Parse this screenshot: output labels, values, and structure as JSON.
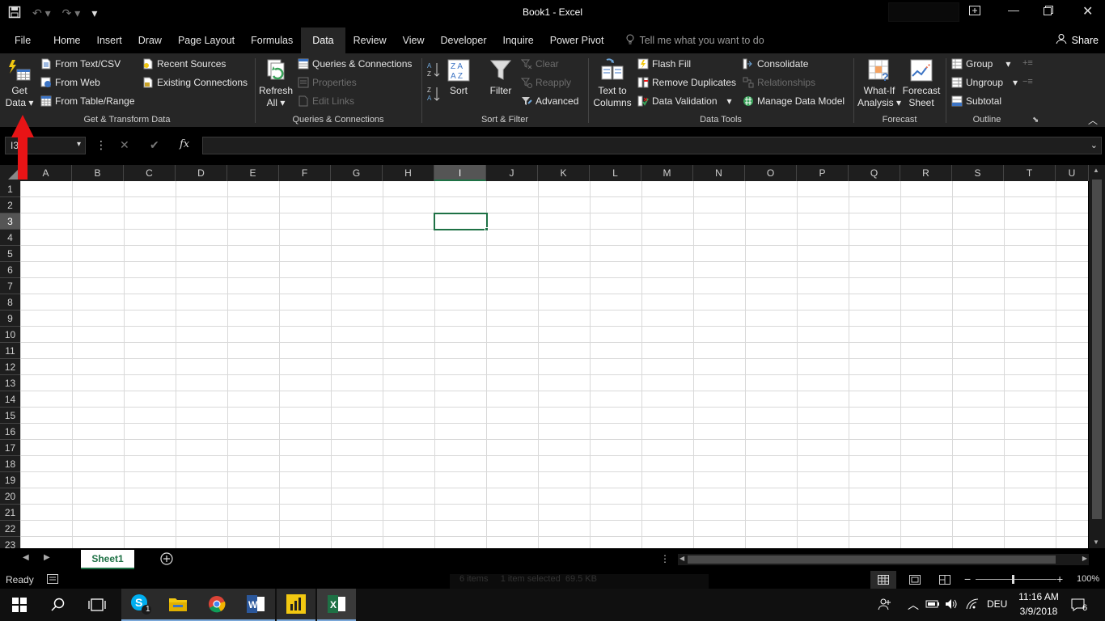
{
  "window": {
    "title": "Book1  -  Excel",
    "qat": {
      "save": "save-icon",
      "undo": "undo-icon",
      "redo": "redo-icon",
      "customize": "▾"
    }
  },
  "tabs": [
    {
      "label": "File"
    },
    {
      "label": "Home"
    },
    {
      "label": "Insert"
    },
    {
      "label": "Draw"
    },
    {
      "label": "Page Layout"
    },
    {
      "label": "Formulas"
    },
    {
      "label": "Data",
      "active": true
    },
    {
      "label": "Review"
    },
    {
      "label": "View"
    },
    {
      "label": "Developer"
    },
    {
      "label": "Inquire"
    },
    {
      "label": "Power Pivot"
    }
  ],
  "tell_me": "Tell me what you want to do",
  "share": "Share",
  "ribbon": {
    "get_transform": {
      "label": "Get & Transform Data",
      "get_data_1": "Get",
      "get_data_2": "Data",
      "from_text_csv": "From Text/CSV",
      "from_web": "From Web",
      "from_table_range": "From Table/Range",
      "recent_sources": "Recent Sources",
      "existing_connections": "Existing Connections"
    },
    "queries": {
      "label": "Queries & Connections",
      "refresh_1": "Refresh",
      "refresh_2": "All",
      "queries_connections": "Queries & Connections",
      "properties": "Properties",
      "edit_links": "Edit Links"
    },
    "sort_filter": {
      "label": "Sort & Filter",
      "sort": "Sort",
      "filter": "Filter",
      "clear": "Clear",
      "reapply": "Reapply",
      "advanced": "Advanced"
    },
    "data_tools": {
      "label": "Data Tools",
      "text_to_1": "Text to",
      "text_to_2": "Columns",
      "flash_fill": "Flash Fill",
      "remove_duplicates": "Remove Duplicates",
      "data_validation": "Data Validation",
      "consolidate": "Consolidate",
      "relationships": "Relationships",
      "manage_data_model": "Manage Data Model"
    },
    "forecast": {
      "label": "Forecast",
      "what_if_1": "What-If",
      "what_if_2": "Analysis",
      "forecast_1": "Forecast",
      "forecast_2": "Sheet"
    },
    "outline": {
      "label": "Outline",
      "group": "Group",
      "ungroup": "Ungroup",
      "subtotal": "Subtotal"
    }
  },
  "formula_bar": {
    "name_box": "I3",
    "fx": "fx",
    "value": ""
  },
  "grid": {
    "columns": [
      "A",
      "B",
      "C",
      "D",
      "E",
      "F",
      "G",
      "H",
      "I",
      "J",
      "K",
      "L",
      "M",
      "N",
      "O",
      "P",
      "Q",
      "R",
      "S",
      "T",
      "U"
    ],
    "selected_column": "I",
    "rows": [
      "1",
      "2",
      "3",
      "4",
      "5",
      "6",
      "7",
      "8",
      "9",
      "10",
      "11",
      "12",
      "13",
      "14",
      "15",
      "16",
      "17",
      "18",
      "19",
      "20",
      "21",
      "22",
      "23"
    ],
    "selected_row": "3"
  },
  "sheets": [
    {
      "label": "Sheet1",
      "active": true
    }
  ],
  "status": {
    "ready": "Ready",
    "explorer_ghost": "6 items     1 item selected  69.5 KB",
    "zoom": "100%"
  },
  "taskbar": {
    "skype_badge": "1",
    "language": "DEU",
    "time": "11:16 AM",
    "date": "3/9/2018",
    "notifications": "6"
  },
  "colors": {
    "accent": "#1e7145",
    "ribbon_bg": "#262626",
    "arrow": "#e81416"
  }
}
